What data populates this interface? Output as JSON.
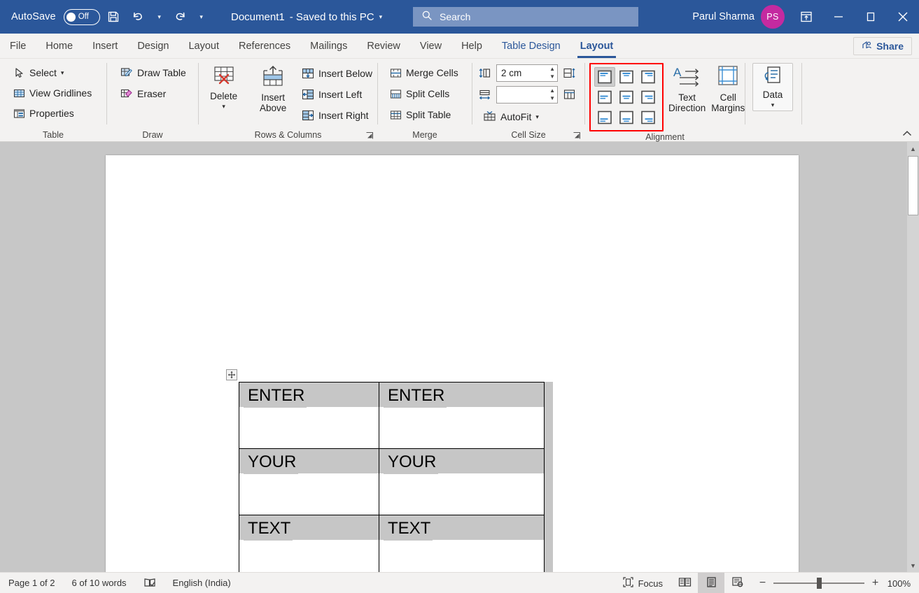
{
  "titlebar": {
    "autosave_label": "AutoSave",
    "autosave_state": "Off",
    "save_icon": "save-icon",
    "undo_icon": "undo-icon",
    "redo_icon": "redo-icon",
    "customize_icon": "customize-quick-access-icon",
    "document_name": "Document1",
    "save_state": "-  Saved to this PC",
    "title_dropdown_icon": "chevron-down-icon",
    "search_placeholder": "Search",
    "search_icon": "search-icon",
    "user_name": "Parul Sharma",
    "user_initials": "PS",
    "ribbon_display_icon": "ribbon-display-options-icon",
    "minimize_icon": "minimize-icon",
    "maximize_icon": "maximize-icon",
    "close_icon": "close-icon",
    "bg_color": "#2b579a",
    "avatar_color": "#c42aa0"
  },
  "tabs": [
    {
      "label": "File",
      "type": "normal"
    },
    {
      "label": "Home",
      "type": "normal"
    },
    {
      "label": "Insert",
      "type": "normal"
    },
    {
      "label": "Design",
      "type": "normal"
    },
    {
      "label": "Layout",
      "type": "normal"
    },
    {
      "label": "References",
      "type": "normal"
    },
    {
      "label": "Mailings",
      "type": "normal"
    },
    {
      "label": "Review",
      "type": "normal"
    },
    {
      "label": "View",
      "type": "normal"
    },
    {
      "label": "Help",
      "type": "normal"
    },
    {
      "label": "Table Design",
      "type": "contextual"
    },
    {
      "label": "Layout",
      "type": "contextual-active"
    }
  ],
  "share": {
    "label": "Share",
    "icon": "share-person-icon"
  },
  "ribbon": {
    "accent_color": "#2b579a",
    "highlight_color": "#ff0000",
    "groups": [
      {
        "name": "Table",
        "label": "Table",
        "items": [
          {
            "label": "Select",
            "icon": "cursor-select-icon",
            "has_dropdown": true
          },
          {
            "label": "View Gridlines",
            "icon": "gridlines-icon",
            "has_dropdown": false
          },
          {
            "label": "Properties",
            "icon": "table-properties-icon",
            "has_dropdown": false
          }
        ]
      },
      {
        "name": "Draw",
        "label": "Draw",
        "items": [
          {
            "label": "Draw Table",
            "icon": "draw-table-pencil-icon",
            "has_dropdown": false
          },
          {
            "label": "Eraser",
            "icon": "eraser-icon",
            "has_dropdown": false
          }
        ]
      },
      {
        "name": "Rows & Columns",
        "label": "Rows & Columns",
        "has_launcher": true,
        "items": [
          {
            "label": "Delete",
            "icon": "delete-table-icon",
            "has_dropdown": true
          },
          {
            "label": "Insert Above",
            "icon": "insert-row-above-icon",
            "has_dropdown": false
          },
          {
            "label": "Insert Below",
            "icon": "insert-row-below-icon",
            "has_dropdown": false
          },
          {
            "label": "Insert Left",
            "icon": "insert-column-left-icon",
            "has_dropdown": false
          },
          {
            "label": "Insert Right",
            "icon": "insert-column-right-icon",
            "has_dropdown": false
          }
        ]
      },
      {
        "name": "Merge",
        "label": "Merge",
        "items": [
          {
            "label": "Merge Cells",
            "icon": "merge-cells-icon",
            "has_dropdown": false
          },
          {
            "label": "Split Cells",
            "icon": "split-cells-icon",
            "has_dropdown": false
          },
          {
            "label": "Split Table",
            "icon": "split-table-icon",
            "has_dropdown": false
          }
        ]
      },
      {
        "name": "Cell Size",
        "label": "Cell Size",
        "has_launcher": true,
        "height_value": "2 cm",
        "height_icon": "row-height-icon",
        "width_value": "",
        "width_icon": "column-width-icon",
        "distribute_rows_icon": "distribute-rows-icon",
        "distribute_cols_icon": "distribute-columns-icon",
        "autofit_label": "AutoFit",
        "autofit_icon": "autofit-icon"
      },
      {
        "name": "Alignment",
        "label": "Alignment",
        "highlighted": true,
        "alignment_buttons": [
          {
            "name": "align-top-left",
            "v": "top",
            "h": "left",
            "selected": true
          },
          {
            "name": "align-top-center",
            "v": "top",
            "h": "center",
            "selected": false
          },
          {
            "name": "align-top-right",
            "v": "top",
            "h": "right",
            "selected": false
          },
          {
            "name": "align-center-left",
            "v": "middle",
            "h": "left",
            "selected": false
          },
          {
            "name": "align-center",
            "v": "middle",
            "h": "center",
            "selected": false
          },
          {
            "name": "align-center-right",
            "v": "middle",
            "h": "right",
            "selected": false
          },
          {
            "name": "align-bottom-left",
            "v": "bottom",
            "h": "left",
            "selected": false
          },
          {
            "name": "align-bottom-center",
            "v": "bottom",
            "h": "center",
            "selected": false
          },
          {
            "name": "align-bottom-right",
            "v": "bottom",
            "h": "right",
            "selected": false
          }
        ],
        "text_direction_label": "Text\nDirection",
        "text_direction_line1": "Text",
        "text_direction_line2": "Direction",
        "text_direction_icon": "text-direction-icon",
        "cell_margins_line1": "Cell",
        "cell_margins_line2": "Margins",
        "cell_margins_icon": "cell-margins-icon"
      },
      {
        "name": "Data",
        "label": "",
        "data_label": "Data",
        "data_icon": "data-sort-icon",
        "has_dropdown": true
      }
    ],
    "collapse_icon": "chevron-up-icon"
  },
  "document": {
    "move_handle_icon": "table-move-handle-icon",
    "resize_handle_icon": "table-resize-handle-icon",
    "table": {
      "rows": [
        [
          "ENTER",
          "ENTER"
        ],
        [
          "YOUR",
          "YOUR"
        ],
        [
          "TEXT",
          "TEXT"
        ]
      ]
    }
  },
  "statusbar": {
    "page_info": "Page 1 of 2",
    "word_count": "6 of 10 words",
    "proofing_icon": "proofing-errors-icon",
    "language": "English (India)",
    "focus_label": "Focus",
    "focus_icon": "focus-mode-icon",
    "read_mode_icon": "read-mode-icon",
    "print_layout_icon": "print-layout-icon",
    "web_layout_icon": "web-layout-icon",
    "zoom_out_icon": "zoom-out-icon",
    "zoom_in_icon": "zoom-in-icon",
    "zoom_level": "100%"
  }
}
